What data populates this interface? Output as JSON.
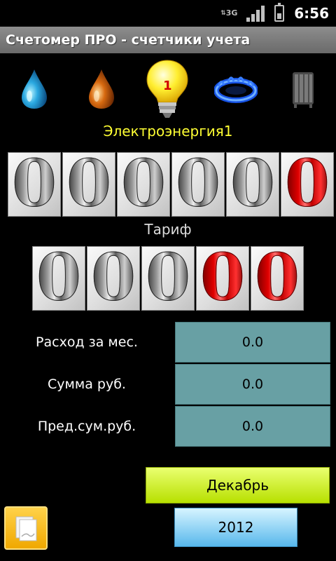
{
  "status_bar": {
    "network": "3G",
    "time": "6:56"
  },
  "app": {
    "title": "Счетомер ПРО - счетчики учета"
  },
  "meter_types": [
    {
      "icon": "water-drop-blue-icon"
    },
    {
      "icon": "water-drop-orange-icon"
    },
    {
      "icon": "light-bulb-icon",
      "badge": "1",
      "selected": true
    },
    {
      "icon": "gas-flame-icon"
    },
    {
      "icon": "radiator-icon"
    }
  ],
  "meter": {
    "name": "Электроэнергия1",
    "reading_digits": [
      {
        "value": "0",
        "style": "silver"
      },
      {
        "value": "0",
        "style": "silver"
      },
      {
        "value": "0",
        "style": "silver"
      },
      {
        "value": "0",
        "style": "silver"
      },
      {
        "value": "0",
        "style": "silver"
      },
      {
        "value": "0",
        "style": "red"
      }
    ],
    "tariff_label": "Тариф",
    "tariff_digits": [
      {
        "value": "0",
        "style": "silver"
      },
      {
        "value": "0",
        "style": "silver"
      },
      {
        "value": "0",
        "style": "silver"
      },
      {
        "value": "0",
        "style": "red"
      },
      {
        "value": "0",
        "style": "red"
      }
    ]
  },
  "stats": [
    {
      "label": "Расход за мес.",
      "value": "0.0"
    },
    {
      "label": "Сумма руб.",
      "value": "0.0"
    },
    {
      "label": "Пред.сум.руб.",
      "value": "0.0"
    }
  ],
  "period": {
    "month": "Декабрь",
    "year": "2012"
  },
  "colors": {
    "meter_name": "#ffff33",
    "stat_value_bg": "#68a0a4",
    "month_button": "#c8f000",
    "year_button": "#7cc8f0"
  }
}
